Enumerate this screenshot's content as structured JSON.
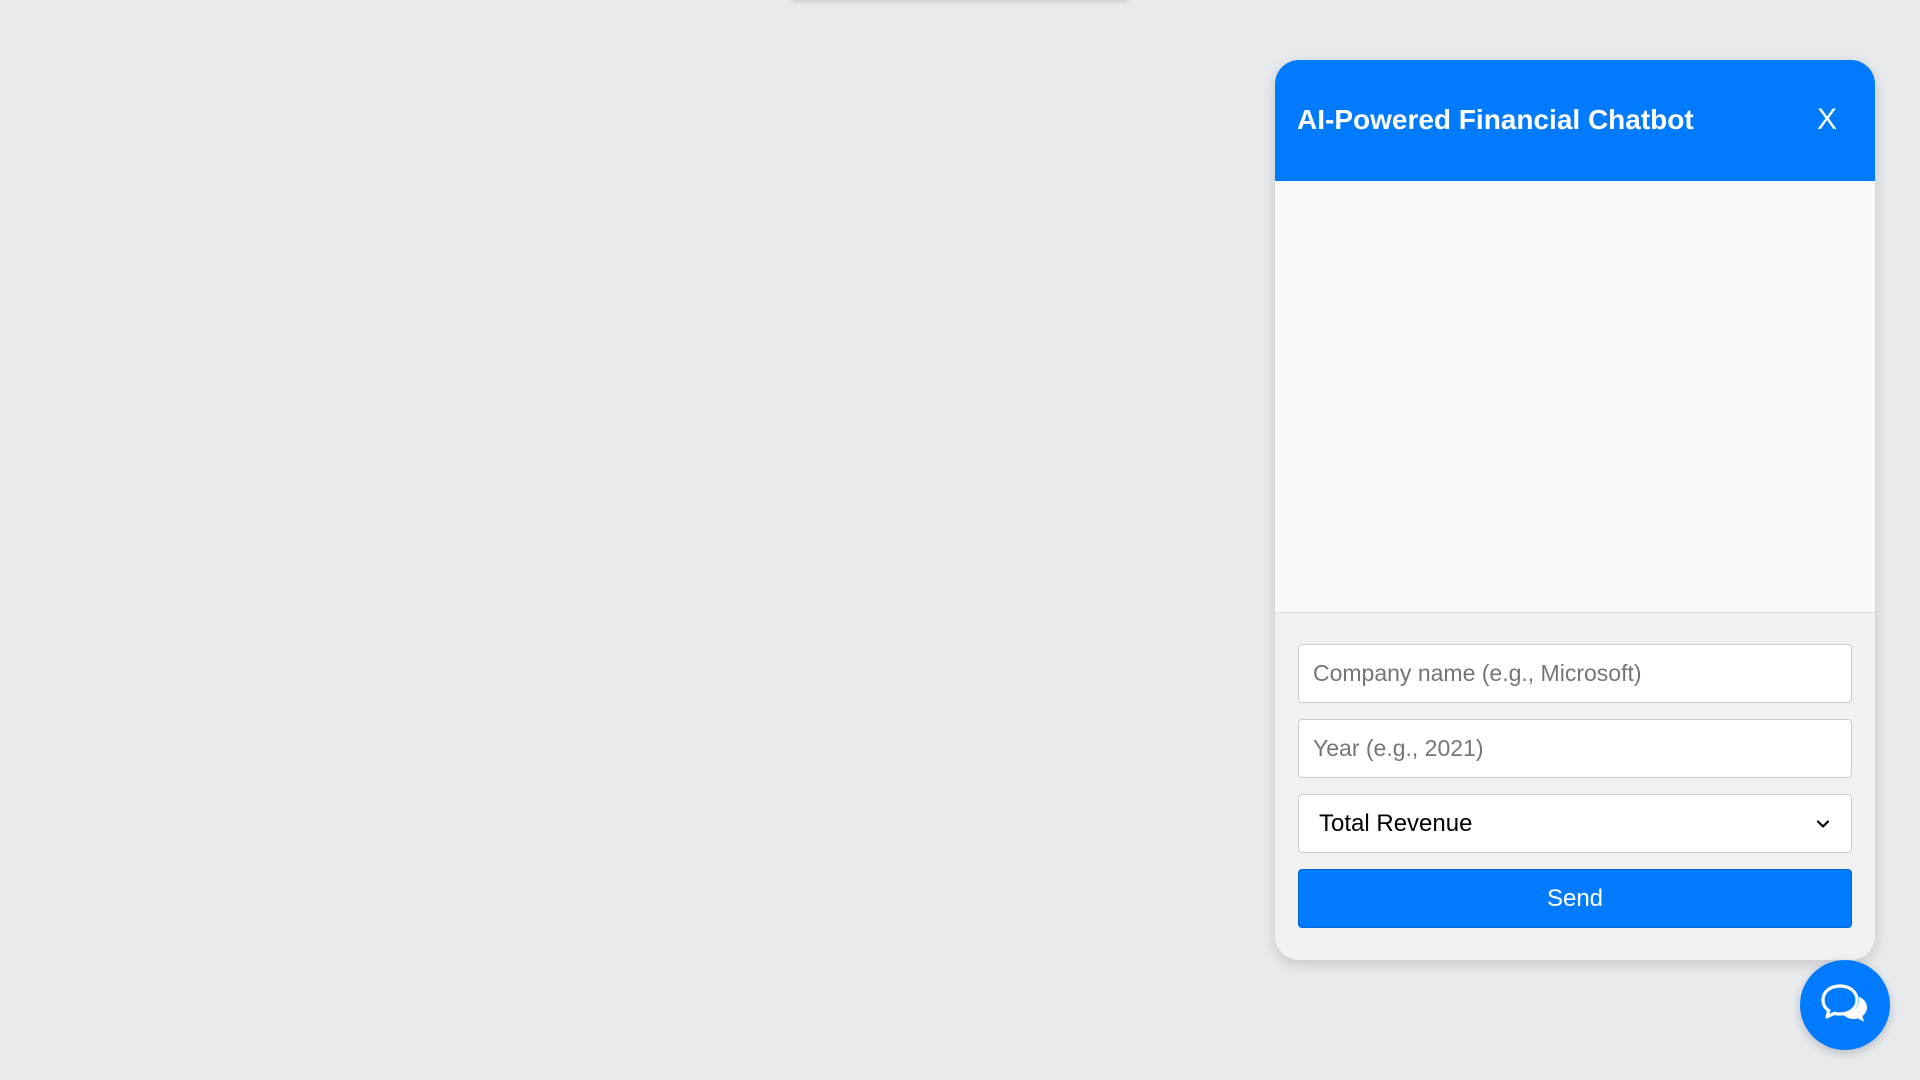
{
  "colors": {
    "page_background": "#e8ebee",
    "accent": "#007bff",
    "messages_background": "#f9f9f9",
    "panel_background": "#f1f1f1"
  },
  "chat": {
    "title": "AI-Powered Financial Chatbot",
    "close_label": "X",
    "messages": [],
    "company_input": {
      "value": "",
      "placeholder": "Company name (e.g., Microsoft)"
    },
    "year_input": {
      "value": "",
      "placeholder": "Year (e.g., 2021)"
    },
    "metric_select": {
      "selected": "Total Revenue"
    },
    "send_label": "Send"
  },
  "icons": {
    "close": "close-icon",
    "dropdown": "chevron-down-icon",
    "chat_toggle": "chat-bubbles-icon"
  }
}
